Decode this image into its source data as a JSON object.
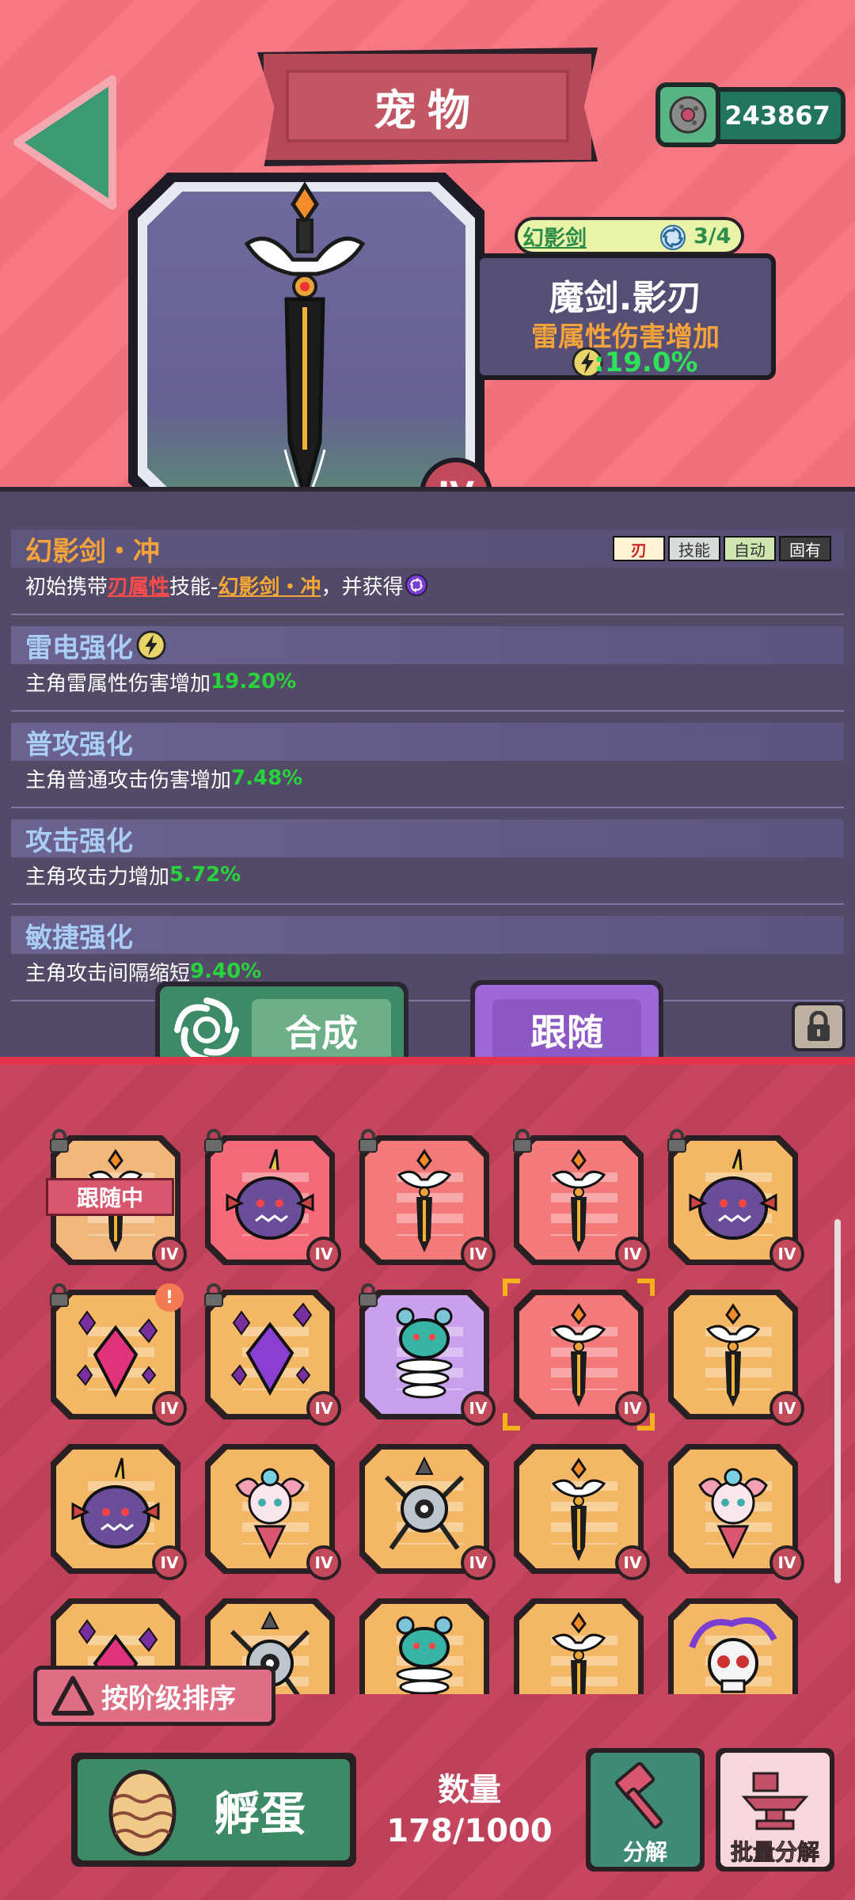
{
  "header": {
    "title": "宠物",
    "currency": "243867"
  },
  "pet": {
    "series": "幻影剑",
    "series_count": "3/4",
    "name": "魔剑.影刃",
    "attribute": "雷属性伤害增加",
    "attribute_value": ":19.0%",
    "tier": "IV"
  },
  "abilities": [
    {
      "title": "幻影剑・冲",
      "desc_prefix": "初始携带",
      "desc_red": "刃属性",
      "desc_mid": "技能-",
      "desc_gold": "幻影剑・冲",
      "desc_suffix": "，并获得",
      "tags": [
        "刃",
        "技能",
        "自动",
        "固有"
      ]
    },
    {
      "title": "雷电强化",
      "desc": "主角雷属性伤害增加",
      "value": "19.20%"
    },
    {
      "title": "普攻强化",
      "desc": "主角普通攻击伤害增加",
      "value": "7.48%"
    },
    {
      "title": "攻击强化",
      "desc": "主角攻击力增加",
      "value": "5.72%"
    },
    {
      "title": "敏捷强化",
      "desc": "主角攻击间隔缩短",
      "value": "9.40%"
    }
  ],
  "actions": {
    "synthesize": "合成",
    "follow": "跟随"
  },
  "inventory": {
    "following_label": "跟随中",
    "tier": "IV",
    "alert": "!",
    "items": [
      {
        "kind": "sword",
        "bg": "#f2b77a",
        "locked": true,
        "following": true
      },
      {
        "kind": "blob",
        "bg": "#f46a78",
        "locked": true
      },
      {
        "kind": "sword",
        "bg": "#f47a7a",
        "locked": true
      },
      {
        "kind": "sword",
        "bg": "#f47a7a",
        "locked": true
      },
      {
        "kind": "blob",
        "bg": "#f3b766",
        "locked": true
      },
      {
        "kind": "crystal",
        "bg": "#f3b766",
        "locked": true,
        "alert": true
      },
      {
        "kind": "crystal-purple",
        "bg": "#f3b766",
        "locked": true
      },
      {
        "kind": "spring",
        "bg": "#c8a0ec",
        "locked": true
      },
      {
        "kind": "sword",
        "bg": "#f47a7a",
        "selected": true
      },
      {
        "kind": "sword",
        "bg": "#f3b766"
      },
      {
        "kind": "blob",
        "bg": "#f3b766"
      },
      {
        "kind": "fairy",
        "bg": "#f3b766"
      },
      {
        "kind": "drone",
        "bg": "#f3b766"
      },
      {
        "kind": "sword",
        "bg": "#f3b766"
      },
      {
        "kind": "fairy",
        "bg": "#f3b766"
      },
      {
        "kind": "crystal",
        "bg": "#f3b766"
      },
      {
        "kind": "drone",
        "bg": "#f3b766"
      },
      {
        "kind": "spring",
        "bg": "#f3b766"
      },
      {
        "kind": "sword",
        "bg": "#f3b766"
      },
      {
        "kind": "skull",
        "bg": "#f3b766"
      }
    ]
  },
  "sort_label": "按阶级排序",
  "hatch_label": "孵蛋",
  "quantity": {
    "label": "数量",
    "value": "178/1000"
  },
  "decompose_label": "分解",
  "batch_decompose_label": "批量分解",
  "colors": {
    "accent_green": "#3c8a66",
    "accent_purple": "#9e68d8",
    "value_green": "#28d33c",
    "header_blue": "#a9cdf4"
  }
}
